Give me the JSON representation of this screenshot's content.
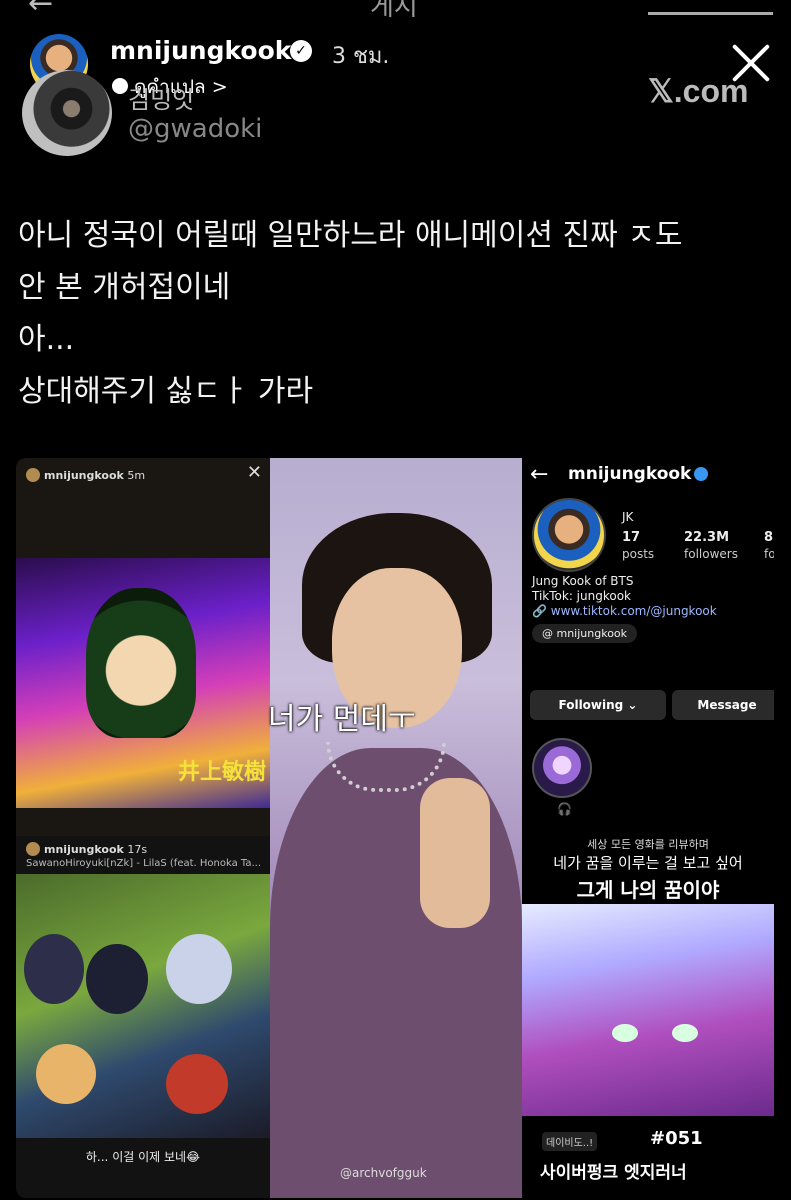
{
  "topbar": {
    "back_glyph": "←",
    "title": "게시"
  },
  "header": {
    "username": "mnijungkook",
    "verified_glyph": "✓",
    "time": "3 ชม.",
    "translate_label": "ดูคำแปล",
    "translate_chevron": ">",
    "close_icon": "close-icon"
  },
  "tweet_source": {
    "name": "김밍잇",
    "handle": "@gwadoki",
    "brand": "𝕏.com"
  },
  "tweet_lines": [
    "아니 정국이 어릴때 일만하느라 애니메이션 진짜 ㅈ도",
    "안 본 개허접이네",
    "아...",
    "상대해주기 싫ㄷㅏ 가라"
  ],
  "collage": {
    "story1": {
      "user": "mnijungkook",
      "time": "5m",
      "close": "✕",
      "kanji": "井上敏樹"
    },
    "story2": {
      "user": "mnijungkook",
      "time": "17s",
      "song": "SawanoHiroyuki[nZk] - LilaS (feat. Honoka Ta...",
      "caption": "하... 이걸 이제 보네😂"
    },
    "center": {
      "caption": "너가 먼데ㅜ",
      "credit": "@archvofgguk"
    },
    "profile": {
      "back": "←",
      "username": "mnijungkook",
      "name": "JK",
      "stats": [
        {
          "n": "17",
          "l": "posts"
        },
        {
          "n": "22.3M",
          "l": "followers"
        },
        {
          "n": "8",
          "l": "fo"
        }
      ],
      "bio_line1": "Jung Kook of BTS",
      "bio_line2": "TikTok: jungkook",
      "bio_link": "www.tiktok.com/@jungkook",
      "threads": "mnijungkook",
      "following_btn": "Following ⌄",
      "message_btn": "Message",
      "highlight_icon": "🎧"
    },
    "review": {
      "line1": "세상 모든 영화를 리뷰하며",
      "line2": "네가 꿈을 이루는 걸 보고 싶어",
      "line3": "그게 나의 꿈이야",
      "badge": "데이비도..!",
      "number": "#051",
      "title": "사이버펑크 엣지러너"
    }
  }
}
